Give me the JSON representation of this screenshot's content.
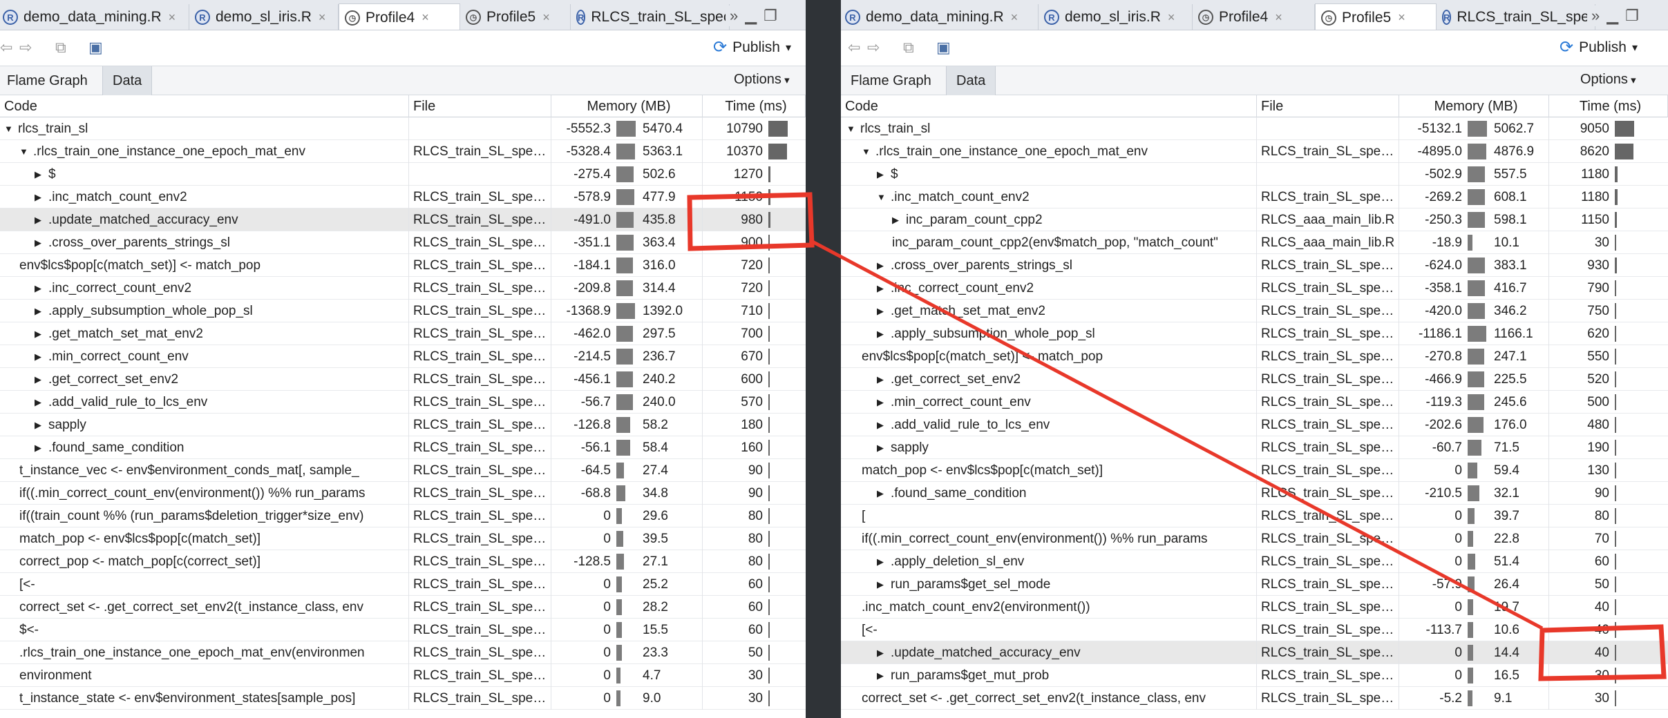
{
  "left": {
    "tabs": [
      {
        "label": "demo_data_mining.R",
        "icon": "r-file-icon"
      },
      {
        "label": "demo_sl_iris.R",
        "icon": "r-file-icon"
      },
      {
        "label": "Profile4",
        "icon": "profile-clock-icon"
      },
      {
        "label": "Profile5",
        "icon": "profile-clock-icon"
      },
      {
        "label": "RLCS_train_SL_specif",
        "icon": "r-file-icon"
      }
    ],
    "active_tab": 2,
    "publish_label": "Publish",
    "view_tabs": [
      "Flame Graph",
      "Data"
    ],
    "options_label": "Options",
    "headers": {
      "code": "Code",
      "file": "File",
      "memory": "Memory (MB)",
      "time": "Time (ms)"
    },
    "rows": [
      {
        "depth": 0,
        "tri": "down",
        "code": "rlcs_train_sl",
        "file": "",
        "mem_neg": "-5552.3",
        "mem_pos": "5470.4",
        "time": "10790",
        "mem_frac": 1.0,
        "time_frac": 1.0
      },
      {
        "depth": 1,
        "tri": "down",
        "code": ".rlcs_train_one_instance_one_epoch_mat_env",
        "file": "RLCS_train_SL_spe…",
        "mem_neg": "-5328.4",
        "mem_pos": "5363.1",
        "time": "10370",
        "mem_frac": 0.98,
        "time_frac": 0.96
      },
      {
        "depth": 2,
        "tri": "right",
        "code": "$",
        "file": "",
        "mem_neg": "-275.4",
        "mem_pos": "502.6",
        "time": "1270",
        "mem_frac": 0.9,
        "time_frac": 0.12
      },
      {
        "depth": 2,
        "tri": "right",
        "code": ".inc_match_count_env2",
        "file": "RLCS_train_SL_spe…",
        "mem_neg": "-578.9",
        "mem_pos": "477.9",
        "time": "1150",
        "mem_frac": 0.92,
        "time_frac": 0.11
      },
      {
        "depth": 2,
        "tri": "right",
        "code": ".update_matched_accuracy_env",
        "file": "RLCS_train_SL_spe…",
        "mem_neg": "-491.0",
        "mem_pos": "435.8",
        "time": "980",
        "mem_frac": 0.9,
        "time_frac": 0.09,
        "highlight": true
      },
      {
        "depth": 2,
        "tri": "right",
        "code": ".cross_over_parents_strings_sl",
        "file": "RLCS_train_SL_spe…",
        "mem_neg": "-351.1",
        "mem_pos": "363.4",
        "time": "900",
        "mem_frac": 0.88,
        "time_frac": 0.08
      },
      {
        "depth": 1,
        "tri": "",
        "code": "env$lcs$pop[c(match_set)] <- match_pop",
        "file": "RLCS_train_SL_spe…",
        "mem_neg": "-184.1",
        "mem_pos": "316.0",
        "time": "720",
        "mem_frac": 0.86,
        "time_frac": 0.07
      },
      {
        "depth": 2,
        "tri": "right",
        "code": ".inc_correct_count_env2",
        "file": "RLCS_train_SL_spe…",
        "mem_neg": "-209.8",
        "mem_pos": "314.4",
        "time": "720",
        "mem_frac": 0.86,
        "time_frac": 0.07
      },
      {
        "depth": 2,
        "tri": "right",
        "code": ".apply_subsumption_whole_pop_sl",
        "file": "RLCS_train_SL_spe…",
        "mem_neg": "-1368.9",
        "mem_pos": "1392.0",
        "time": "710",
        "mem_frac": 0.95,
        "time_frac": 0.07
      },
      {
        "depth": 2,
        "tri": "right",
        "code": ".get_match_set_mat_env2",
        "file": "RLCS_train_SL_spe…",
        "mem_neg": "-462.0",
        "mem_pos": "297.5",
        "time": "700",
        "mem_frac": 0.86,
        "time_frac": 0.06
      },
      {
        "depth": 2,
        "tri": "right",
        "code": ".min_correct_count_env",
        "file": "RLCS_train_SL_spe…",
        "mem_neg": "-214.5",
        "mem_pos": "236.7",
        "time": "670",
        "mem_frac": 0.84,
        "time_frac": 0.06
      },
      {
        "depth": 2,
        "tri": "right",
        "code": ".get_correct_set_env2",
        "file": "RLCS_train_SL_spe…",
        "mem_neg": "-456.1",
        "mem_pos": "240.2",
        "time": "600",
        "mem_frac": 0.84,
        "time_frac": 0.06
      },
      {
        "depth": 2,
        "tri": "right",
        "code": ".add_valid_rule_to_lcs_env",
        "file": "RLCS_train_SL_spe…",
        "mem_neg": "-56.7",
        "mem_pos": "240.0",
        "time": "570",
        "mem_frac": 0.84,
        "time_frac": 0.05
      },
      {
        "depth": 2,
        "tri": "right",
        "code": "sapply",
        "file": "RLCS_train_SL_spe…",
        "mem_neg": "-126.8",
        "mem_pos": "58.2",
        "time": "180",
        "mem_frac": 0.7,
        "time_frac": 0.02
      },
      {
        "depth": 2,
        "tri": "right",
        "code": ".found_same_condition",
        "file": "RLCS_train_SL_spe…",
        "mem_neg": "-56.1",
        "mem_pos": "58.4",
        "time": "160",
        "mem_frac": 0.7,
        "time_frac": 0.02
      },
      {
        "depth": 1,
        "tri": "",
        "code": "t_instance_vec <- env$environment_conds_mat[, sample_",
        "file": "RLCS_train_SL_spe…",
        "mem_neg": "-64.5",
        "mem_pos": "27.4",
        "time": "90",
        "mem_frac": 0.4,
        "time_frac": 0.0
      },
      {
        "depth": 1,
        "tri": "",
        "code": "if((.min_correct_count_env(environment()) %% run_params",
        "file": "RLCS_train_SL_spe…",
        "mem_neg": "-68.8",
        "mem_pos": "34.8",
        "time": "90",
        "mem_frac": 0.45,
        "time_frac": 0.0
      },
      {
        "depth": 1,
        "tri": "",
        "code": "if((train_count %% (run_params$deletion_trigger*size_env)",
        "file": "RLCS_train_SL_spe…",
        "mem_neg": "0",
        "mem_pos": "29.6",
        "time": "80",
        "mem_frac": 0.3,
        "time_frac": 0.0
      },
      {
        "depth": 1,
        "tri": "",
        "code": "match_pop <- env$lcs$pop[c(match_set)]",
        "file": "RLCS_train_SL_spe…",
        "mem_neg": "0",
        "mem_pos": "39.5",
        "time": "80",
        "mem_frac": 0.35,
        "time_frac": 0.0
      },
      {
        "depth": 1,
        "tri": "",
        "code": "correct_pop <- match_pop[c(correct_set)]",
        "file": "RLCS_train_SL_spe…",
        "mem_neg": "-128.5",
        "mem_pos": "27.1",
        "time": "80",
        "mem_frac": 0.4,
        "time_frac": 0.0
      },
      {
        "depth": 1,
        "tri": "",
        "code": "[<-",
        "file": "RLCS_train_SL_spe…",
        "mem_neg": "0",
        "mem_pos": "25.2",
        "time": "60",
        "mem_frac": 0.3,
        "time_frac": 0.0
      },
      {
        "depth": 1,
        "tri": "",
        "code": "correct_set <- .get_correct_set_env2(t_instance_class, env",
        "file": "RLCS_train_SL_spe…",
        "mem_neg": "0",
        "mem_pos": "28.2",
        "time": "60",
        "mem_frac": 0.3,
        "time_frac": 0.0
      },
      {
        "depth": 1,
        "tri": "",
        "code": "$<-",
        "file": "RLCS_train_SL_spe…",
        "mem_neg": "0",
        "mem_pos": "15.5",
        "time": "60",
        "mem_frac": 0.3,
        "time_frac": 0.0
      },
      {
        "depth": 1,
        "tri": "",
        "code": ".rlcs_train_one_instance_one_epoch_mat_env(environmen",
        "file": "RLCS_train_SL_spe…",
        "mem_neg": "0",
        "mem_pos": "23.3",
        "time": "50",
        "mem_frac": 0.3,
        "time_frac": 0.0
      },
      {
        "depth": 1,
        "tri": "",
        "code": "environment",
        "file": "RLCS_train_SL_spe…",
        "mem_neg": "0",
        "mem_pos": "4.7",
        "time": "30",
        "mem_frac": 0.2,
        "time_frac": 0.0
      },
      {
        "depth": 1,
        "tri": "",
        "code": "t_instance_state <- env$environment_states[sample_pos]",
        "file": "RLCS_train_SL_spe…",
        "mem_neg": "0",
        "mem_pos": "9.0",
        "time": "30",
        "mem_frac": 0.2,
        "time_frac": 0.0
      }
    ]
  },
  "right": {
    "tabs": [
      {
        "label": "demo_data_mining.R",
        "icon": "r-file-icon"
      },
      {
        "label": "demo_sl_iris.R",
        "icon": "r-file-icon"
      },
      {
        "label": "Profile4",
        "icon": "profile-clock-icon"
      },
      {
        "label": "Profile5",
        "icon": "profile-clock-icon"
      },
      {
        "label": "RLCS_train_SL_specif",
        "icon": "r-file-icon"
      }
    ],
    "active_tab": 3,
    "publish_label": "Publish",
    "view_tabs": [
      "Flame Graph",
      "Data"
    ],
    "options_label": "Options",
    "headers": {
      "code": "Code",
      "file": "File",
      "memory": "Memory (MB)",
      "time": "Time (ms)"
    },
    "rows": [
      {
        "depth": 0,
        "tri": "down",
        "code": "rlcs_train_sl",
        "file": "",
        "mem_neg": "-5132.1",
        "mem_pos": "5062.7",
        "time": "9050",
        "mem_frac": 1.0,
        "time_frac": 1.0
      },
      {
        "depth": 1,
        "tri": "down",
        "code": ".rlcs_train_one_instance_one_epoch_mat_env",
        "file": "RLCS_train_SL_spe…",
        "mem_neg": "-4895.0",
        "mem_pos": "4876.9",
        "time": "8620",
        "mem_frac": 0.98,
        "time_frac": 0.95
      },
      {
        "depth": 2,
        "tri": "right",
        "code": "$",
        "file": "",
        "mem_neg": "-502.9",
        "mem_pos": "557.5",
        "time": "1180",
        "mem_frac": 0.9,
        "time_frac": 0.13
      },
      {
        "depth": 2,
        "tri": "down",
        "code": ".inc_match_count_env2",
        "file": "RLCS_train_SL_spe…",
        "mem_neg": "-269.2",
        "mem_pos": "608.1",
        "time": "1180",
        "mem_frac": 0.9,
        "time_frac": 0.13
      },
      {
        "depth": 3,
        "tri": "right",
        "code": "inc_param_count_cpp2",
        "file": "RLCS_aaa_main_lib.R",
        "mem_neg": "-250.3",
        "mem_pos": "598.1",
        "time": "1150",
        "mem_frac": 0.9,
        "time_frac": 0.12
      },
      {
        "depth": 3,
        "tri": "",
        "code": "inc_param_count_cpp2(env$match_pop, \"match_count\"",
        "file": "RLCS_aaa_main_lib.R",
        "mem_neg": "-18.9",
        "mem_pos": "10.1",
        "time": "30",
        "mem_frac": 0.25,
        "time_frac": 0.0
      },
      {
        "depth": 2,
        "tri": "right",
        "code": ".cross_over_parents_strings_sl",
        "file": "RLCS_train_SL_spe…",
        "mem_neg": "-624.0",
        "mem_pos": "383.1",
        "time": "930",
        "mem_frac": 0.88,
        "time_frac": 0.1
      },
      {
        "depth": 2,
        "tri": "right",
        "code": ".inc_correct_count_env2",
        "file": "RLCS_train_SL_spe…",
        "mem_neg": "-358.1",
        "mem_pos": "416.7",
        "time": "790",
        "mem_frac": 0.88,
        "time_frac": 0.08
      },
      {
        "depth": 2,
        "tri": "right",
        "code": ".get_match_set_mat_env2",
        "file": "RLCS_train_SL_spe…",
        "mem_neg": "-420.0",
        "mem_pos": "346.2",
        "time": "750",
        "mem_frac": 0.88,
        "time_frac": 0.08
      },
      {
        "depth": 2,
        "tri": "right",
        "code": ".apply_subsumption_whole_pop_sl",
        "file": "RLCS_train_SL_spe…",
        "mem_neg": "-1186.1",
        "mem_pos": "1166.1",
        "time": "620",
        "mem_frac": 0.95,
        "time_frac": 0.07
      },
      {
        "depth": 1,
        "tri": "",
        "code": "env$lcs$pop[c(match_set)] <- match_pop",
        "file": "RLCS_train_SL_spe…",
        "mem_neg": "-270.8",
        "mem_pos": "247.1",
        "time": "550",
        "mem_frac": 0.85,
        "time_frac": 0.06
      },
      {
        "depth": 2,
        "tri": "right",
        "code": ".get_correct_set_env2",
        "file": "RLCS_train_SL_spe…",
        "mem_neg": "-466.9",
        "mem_pos": "225.5",
        "time": "520",
        "mem_frac": 0.85,
        "time_frac": 0.06
      },
      {
        "depth": 2,
        "tri": "right",
        "code": ".min_correct_count_env",
        "file": "RLCS_train_SL_spe…",
        "mem_neg": "-119.3",
        "mem_pos": "245.6",
        "time": "500",
        "mem_frac": 0.85,
        "time_frac": 0.05
      },
      {
        "depth": 2,
        "tri": "right",
        "code": ".add_valid_rule_to_lcs_env",
        "file": "RLCS_train_SL_spe…",
        "mem_neg": "-202.6",
        "mem_pos": "176.0",
        "time": "480",
        "mem_frac": 0.82,
        "time_frac": 0.05
      },
      {
        "depth": 2,
        "tri": "right",
        "code": "sapply",
        "file": "RLCS_train_SL_spe…",
        "mem_neg": "-60.7",
        "mem_pos": "71.5",
        "time": "190",
        "mem_frac": 0.7,
        "time_frac": 0.02
      },
      {
        "depth": 1,
        "tri": "",
        "code": "match_pop <- env$lcs$pop[c(match_set)]",
        "file": "RLCS_train_SL_spe…",
        "mem_neg": "0",
        "mem_pos": "59.4",
        "time": "130",
        "mem_frac": 0.5,
        "time_frac": 0.01
      },
      {
        "depth": 2,
        "tri": "right",
        "code": ".found_same_condition",
        "file": "RLCS_train_SL_spe…",
        "mem_neg": "-210.5",
        "mem_pos": "32.1",
        "time": "90",
        "mem_frac": 0.6,
        "time_frac": 0.0
      },
      {
        "depth": 1,
        "tri": "",
        "code": "[",
        "file": "RLCS_train_SL_spe…",
        "mem_neg": "0",
        "mem_pos": "39.7",
        "time": "80",
        "mem_frac": 0.35,
        "time_frac": 0.0
      },
      {
        "depth": 1,
        "tri": "",
        "code": "if((.min_correct_count_env(environment()) %% run_params",
        "file": "RLCS_train_SL_spe…",
        "mem_neg": "0",
        "mem_pos": "22.8",
        "time": "70",
        "mem_frac": 0.3,
        "time_frac": 0.0
      },
      {
        "depth": 2,
        "tri": "right",
        "code": ".apply_deletion_sl_env",
        "file": "RLCS_train_SL_spe…",
        "mem_neg": "0",
        "mem_pos": "51.4",
        "time": "60",
        "mem_frac": 0.4,
        "time_frac": 0.0
      },
      {
        "depth": 2,
        "tri": "right",
        "code": "run_params$get_sel_mode",
        "file": "RLCS_train_SL_spe…",
        "mem_neg": "-57.9",
        "mem_pos": "26.4",
        "time": "50",
        "mem_frac": 0.35,
        "time_frac": 0.0
      },
      {
        "depth": 1,
        "tri": "",
        "code": ".inc_match_count_env2(environment())",
        "file": "RLCS_train_SL_spe…",
        "mem_neg": "0",
        "mem_pos": "19.7",
        "time": "40",
        "mem_frac": 0.3,
        "time_frac": 0.0
      },
      {
        "depth": 1,
        "tri": "",
        "code": "[<-",
        "file": "RLCS_train_SL_spe…",
        "mem_neg": "-113.7",
        "mem_pos": "10.6",
        "time": "40",
        "mem_frac": 0.3,
        "time_frac": 0.0
      },
      {
        "depth": 2,
        "tri": "right",
        "code": ".update_matched_accuracy_env",
        "file": "RLCS_train_SL_spe…",
        "mem_neg": "0",
        "mem_pos": "14.4",
        "time": "40",
        "mem_frac": 0.3,
        "time_frac": 0.0,
        "highlight": true
      },
      {
        "depth": 2,
        "tri": "right",
        "code": "run_params$get_mut_prob",
        "file": "RLCS_train_SL_spe…",
        "mem_neg": "0",
        "mem_pos": "16.5",
        "time": "30",
        "mem_frac": 0.3,
        "time_frac": 0.0
      },
      {
        "depth": 1,
        "tri": "",
        "code": "correct_set <- .get_correct_set_env2(t_instance_class, env",
        "file": "RLCS_train_SL_spe…",
        "mem_neg": "-5.2",
        "mem_pos": "9.1",
        "time": "30",
        "mem_frac": 0.25,
        "time_frac": 0.0
      }
    ]
  },
  "annotation_color": "#e8382a"
}
